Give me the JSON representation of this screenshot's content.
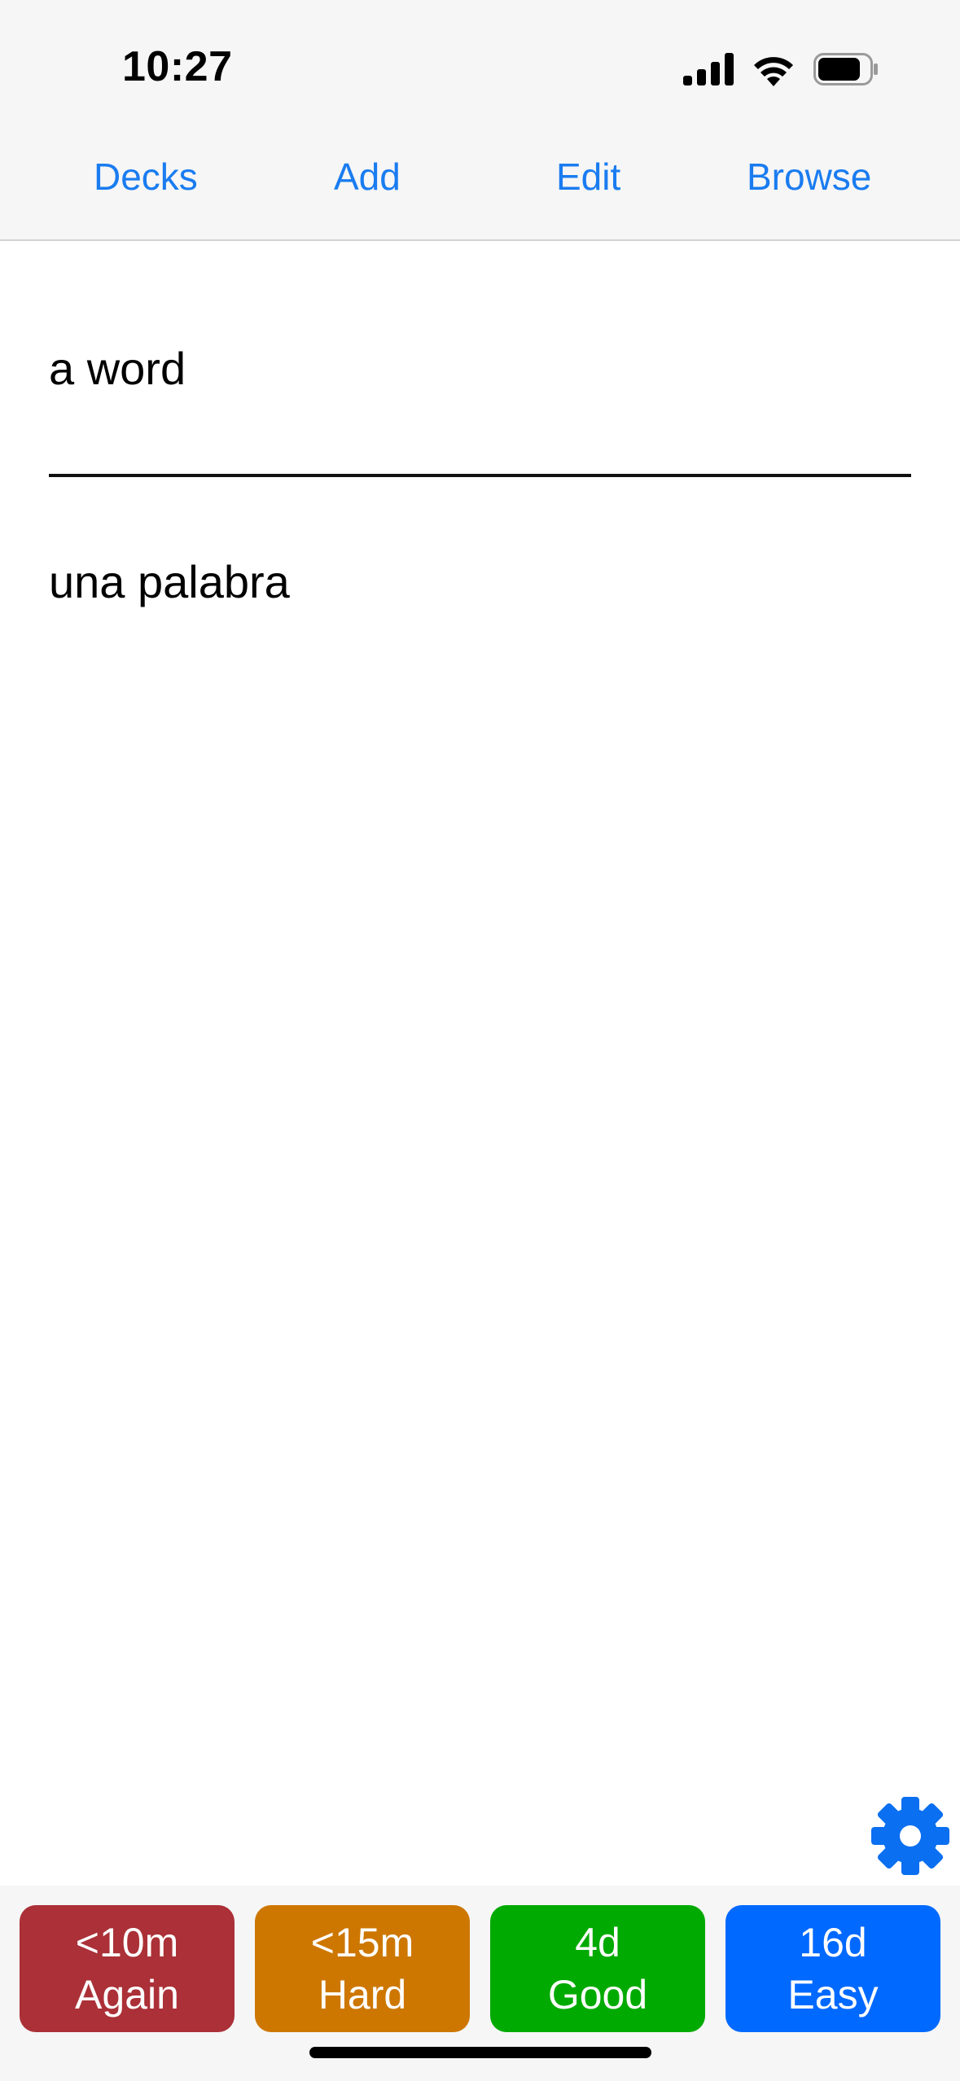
{
  "status": {
    "time": "10:27",
    "icons": [
      "signal-icon",
      "wifi-icon",
      "battery-icon"
    ]
  },
  "nav": {
    "decks": "Decks",
    "add": "Add",
    "edit": "Edit",
    "browse": "Browse"
  },
  "card": {
    "front": "a word",
    "back": "una palabra"
  },
  "answers": [
    {
      "interval": "<10m",
      "label": "Again",
      "color": "#ab3037"
    },
    {
      "interval": "<15m",
      "label": "Hard",
      "color": "#cd7700"
    },
    {
      "interval": "4d",
      "label": "Good",
      "color": "#00aa00"
    },
    {
      "interval": "16d",
      "label": "Easy",
      "color": "#0069ff"
    }
  ],
  "colors": {
    "accent": "#1a7cf0",
    "gear": "#0a6ff0"
  }
}
